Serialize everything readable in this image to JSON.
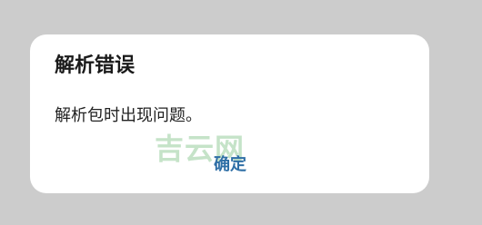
{
  "dialog": {
    "title": "解析错误",
    "message": "解析包时出现问题。",
    "ok_label": "确定",
    "watermark_text": "吉云网"
  },
  "colors": {
    "backdrop": "#cccccc",
    "dialog_background": "#ffffff",
    "button_text": "#2f6fa6",
    "watermark": "#c5e3c8"
  }
}
